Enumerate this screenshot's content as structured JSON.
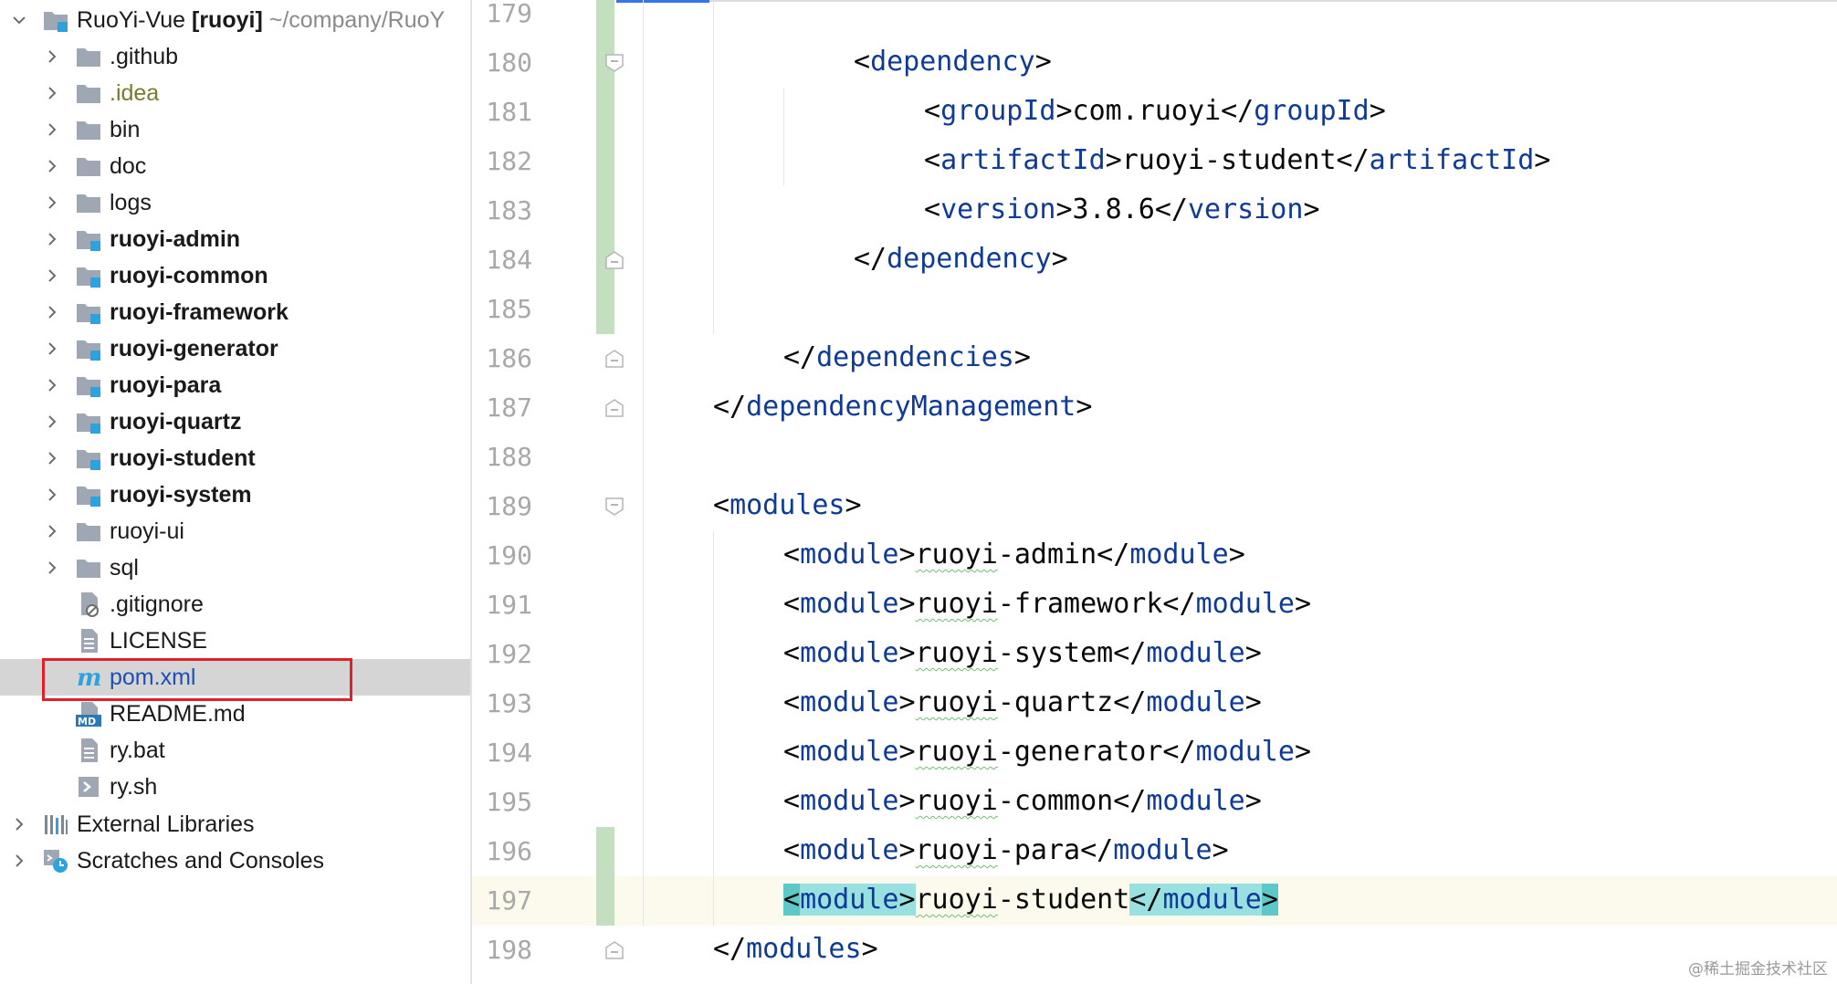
{
  "project_tree": {
    "root": {
      "name": "RuoYi-Vue",
      "module": "[ruoyi]",
      "path": "~/company/RuoY"
    },
    "items": [
      {
        "label": ".github",
        "type": "folder",
        "bold": false,
        "style": "normal"
      },
      {
        "label": ".idea",
        "type": "folder",
        "bold": false,
        "style": "idea"
      },
      {
        "label": "bin",
        "type": "folder",
        "bold": false,
        "style": "normal"
      },
      {
        "label": "doc",
        "type": "folder",
        "bold": false,
        "style": "normal"
      },
      {
        "label": "logs",
        "type": "folder",
        "bold": false,
        "style": "normal"
      },
      {
        "label": "ruoyi-admin",
        "type": "module",
        "bold": true,
        "style": "normal"
      },
      {
        "label": "ruoyi-common",
        "type": "module",
        "bold": true,
        "style": "normal"
      },
      {
        "label": "ruoyi-framework",
        "type": "module",
        "bold": true,
        "style": "normal"
      },
      {
        "label": "ruoyi-generator",
        "type": "module",
        "bold": true,
        "style": "normal"
      },
      {
        "label": "ruoyi-para",
        "type": "module",
        "bold": true,
        "style": "normal"
      },
      {
        "label": "ruoyi-quartz",
        "type": "module",
        "bold": true,
        "style": "normal"
      },
      {
        "label": "ruoyi-student",
        "type": "module",
        "bold": true,
        "style": "normal"
      },
      {
        "label": "ruoyi-system",
        "type": "module",
        "bold": true,
        "style": "normal"
      },
      {
        "label": "ruoyi-ui",
        "type": "folder",
        "bold": false,
        "style": "normal"
      },
      {
        "label": "sql",
        "type": "folder",
        "bold": false,
        "style": "normal"
      },
      {
        "label": ".gitignore",
        "type": "gitignore",
        "bold": false,
        "style": "normal"
      },
      {
        "label": "LICENSE",
        "type": "text",
        "bold": false,
        "style": "normal"
      },
      {
        "label": "pom.xml",
        "type": "maven",
        "bold": false,
        "style": "pom",
        "selected": true
      },
      {
        "label": "README.md",
        "type": "markdown",
        "bold": false,
        "style": "normal"
      },
      {
        "label": "ry.bat",
        "type": "text",
        "bold": false,
        "style": "normal"
      },
      {
        "label": "ry.sh",
        "type": "shell",
        "bold": false,
        "style": "normal"
      }
    ],
    "external_libraries": "External Libraries",
    "scratches": "Scratches and Consoles"
  },
  "editor": {
    "file": "pom.xml",
    "lines": [
      {
        "n": "179",
        "text": ""
      },
      {
        "n": "180",
        "text": "<dependency>"
      },
      {
        "n": "181",
        "text": "<groupId>com.ruoyi</groupId>"
      },
      {
        "n": "182",
        "text": "<artifactId>ruoyi-student</artifactId>"
      },
      {
        "n": "183",
        "text": "<version>3.8.6</version>"
      },
      {
        "n": "184",
        "text": "</dependency>"
      },
      {
        "n": "185",
        "text": ""
      },
      {
        "n": "186",
        "text": "</dependencies>"
      },
      {
        "n": "187",
        "text": "</dependencyManagement>"
      },
      {
        "n": "188",
        "text": ""
      },
      {
        "n": "189",
        "text": "<modules>"
      },
      {
        "n": "190",
        "text": "<module>ruoyi-admin</module>"
      },
      {
        "n": "191",
        "text": "<module>ruoyi-framework</module>"
      },
      {
        "n": "192",
        "text": "<module>ruoyi-system</module>"
      },
      {
        "n": "193",
        "text": "<module>ruoyi-quartz</module>"
      },
      {
        "n": "194",
        "text": "<module>ruoyi-generator</module>"
      },
      {
        "n": "195",
        "text": "<module>ruoyi-common</module>"
      },
      {
        "n": "196",
        "text": "<module>ruoyi-para</module>"
      },
      {
        "n": "197",
        "text": "<module>ruoyi-student</module>"
      },
      {
        "n": "198",
        "text": "</modules>"
      }
    ]
  },
  "watermark": "@稀土掘金技术社区",
  "colors": {
    "tag": "#0f3a96",
    "vcs_added": "#c3dfc0",
    "selection": "#d5d5d5",
    "highlight_box": "#e0202a",
    "current_line": "#fcfaed",
    "brace_match": "#99e0e0"
  }
}
